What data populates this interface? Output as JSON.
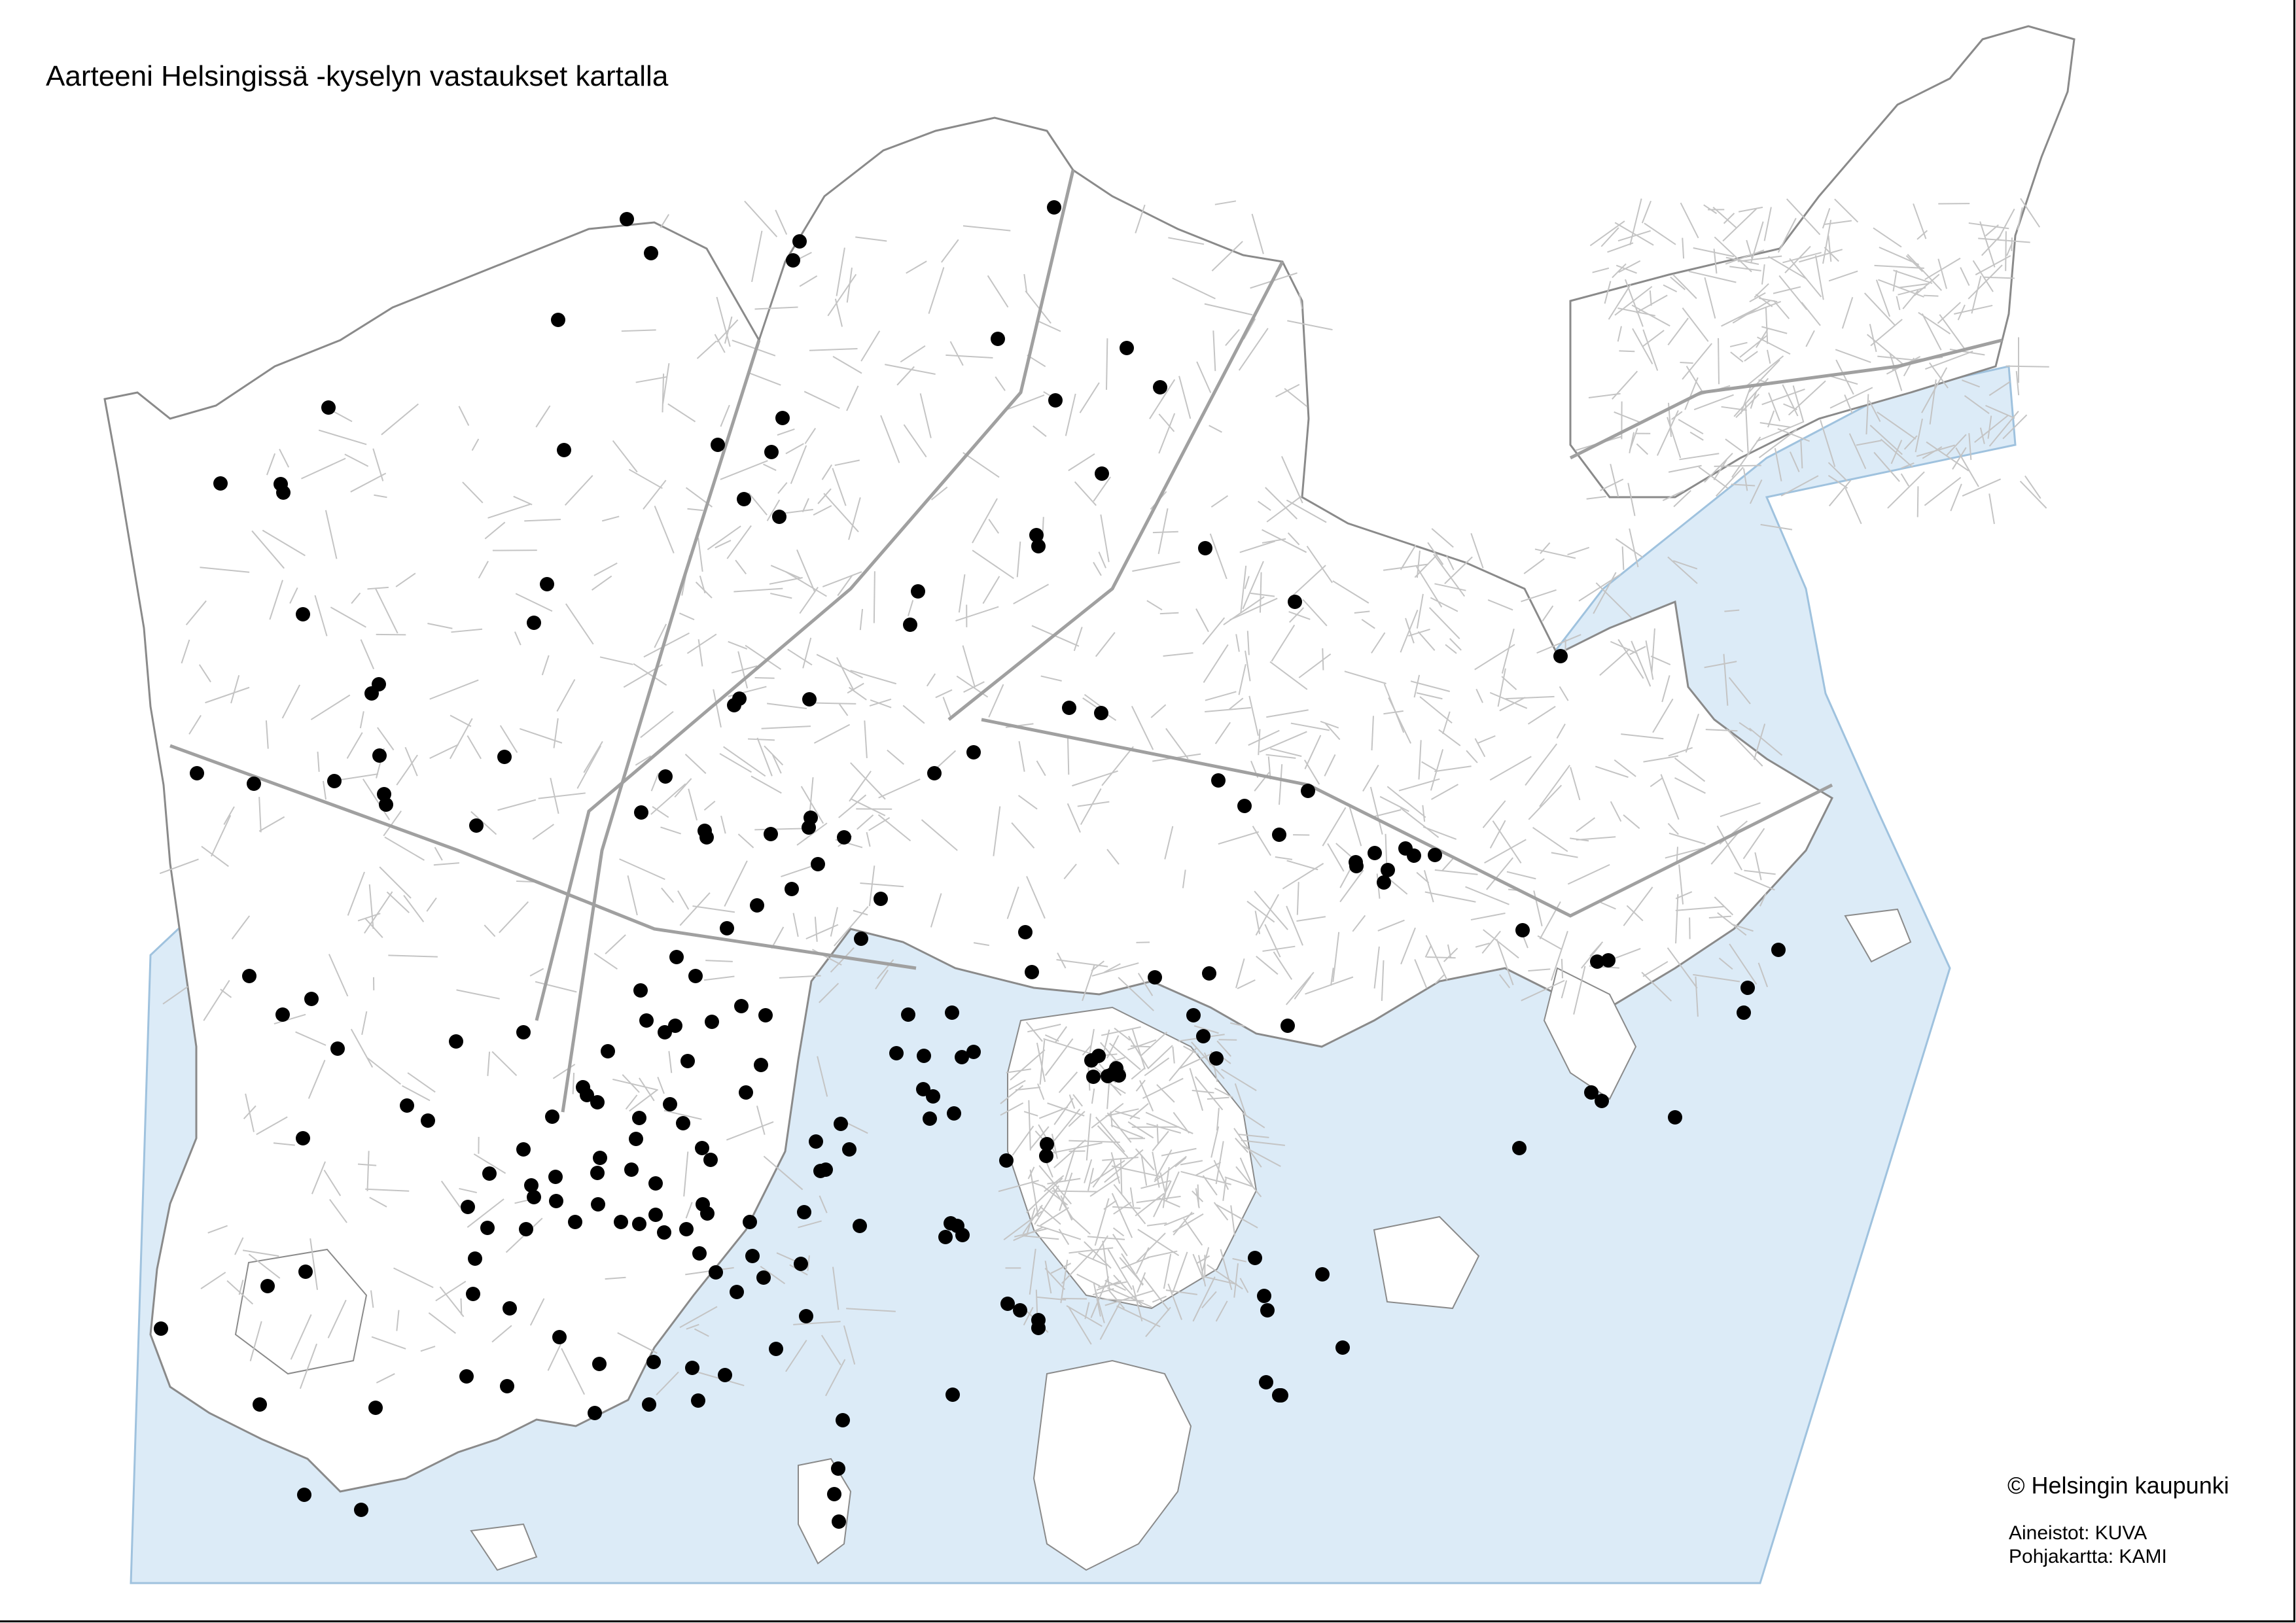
{
  "map": {
    "title": "Aarteeni Helsingissä -kyselyn vastaukset kartalla",
    "copyright": "© Helsingin kaupunki",
    "source_lines": [
      "Aineistot: KUVA",
      "Pohjakartta: KAMI"
    ],
    "colors": {
      "sea": "#dcebf7",
      "land": "#ffffff",
      "streets": "#bfbfbf",
      "district_edges": "#9a9a9a",
      "marker": "#000000"
    },
    "marker_icon": "filled-circle",
    "survey_points_description": "Survey responses shown as black dot markers"
  }
}
